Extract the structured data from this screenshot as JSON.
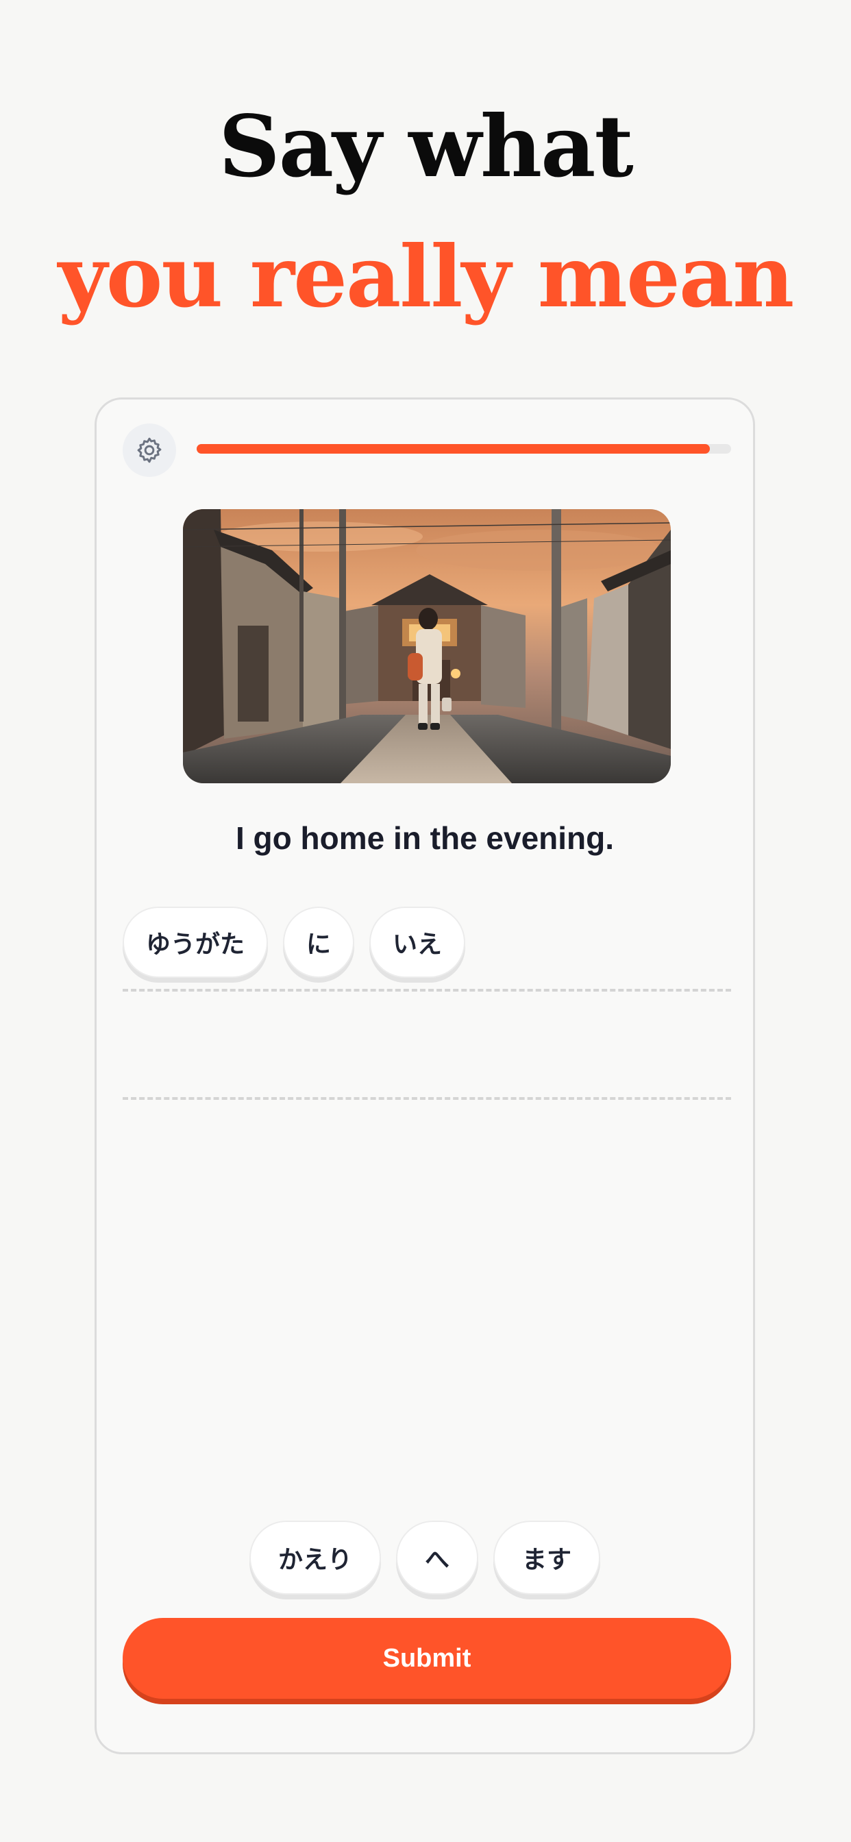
{
  "headline": {
    "line1": "Say what",
    "line2": "you really mean"
  },
  "lesson": {
    "progress_fraction": 0.96,
    "prompt": "I go home in the evening.",
    "answer_tiles": [
      "ゆうがた",
      "に",
      "いえ"
    ],
    "word_bank": [
      "かえり",
      "へ",
      "ます"
    ],
    "submit_label": "Submit"
  },
  "colors": {
    "accent": "#ff5429",
    "title_dark": "#0b0b0b",
    "text_dark": "#1a1d2b",
    "background": "#f7f7f5"
  },
  "icons": {
    "settings": "gear-icon"
  }
}
